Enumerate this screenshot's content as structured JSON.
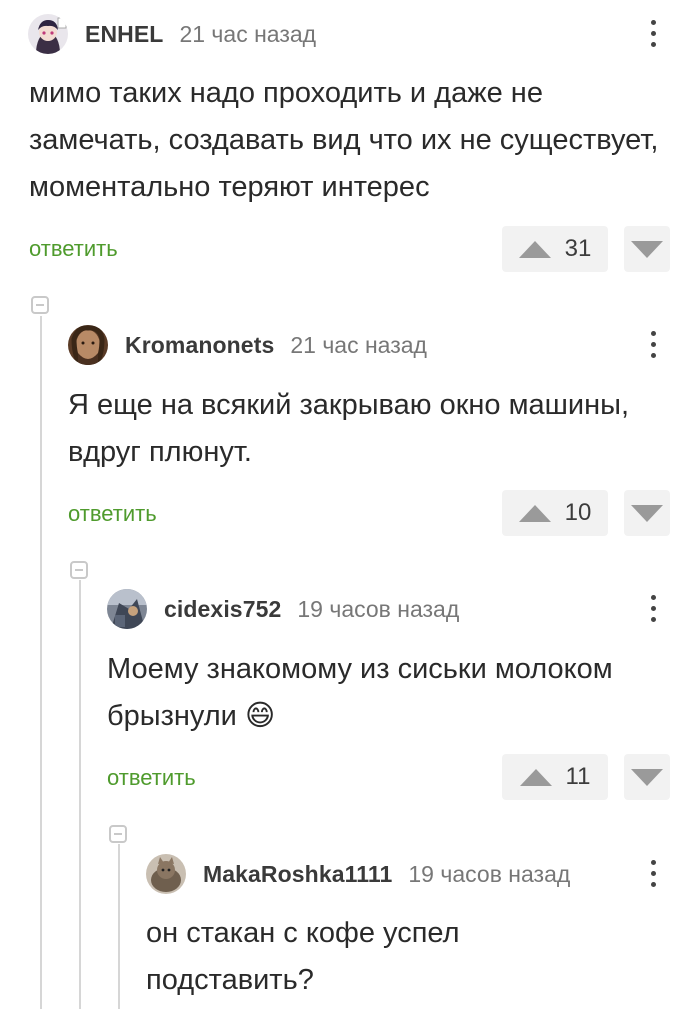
{
  "comments": [
    {
      "author": "ENHEL",
      "time": "21 час назад",
      "text": "мимо таких надо проходить и даже не замечать, создавать вид что их не существует, моментально теряют интерес",
      "reply": "ответить",
      "votes": "31"
    },
    {
      "author": "Kromanonets",
      "time": "21 час назад",
      "text": "Я еще на всякий закрываю окно машины, вдруг плюнут.",
      "reply": "ответить",
      "votes": "10"
    },
    {
      "author": "cidexis752",
      "time": "19 часов назад",
      "text": "Моему знакомому из сиськи молоком брызнули",
      "emoji": "😄",
      "reply": "ответить",
      "votes": "11"
    },
    {
      "author": "MakaRoshka1111",
      "time": "19 часов назад",
      "text": "он стакан с кофе успел подставить?"
    }
  ],
  "colors": {
    "reply": "#4f9b2d",
    "vote_bg": "#f2f2f2",
    "thread": "#d6d6d6"
  }
}
